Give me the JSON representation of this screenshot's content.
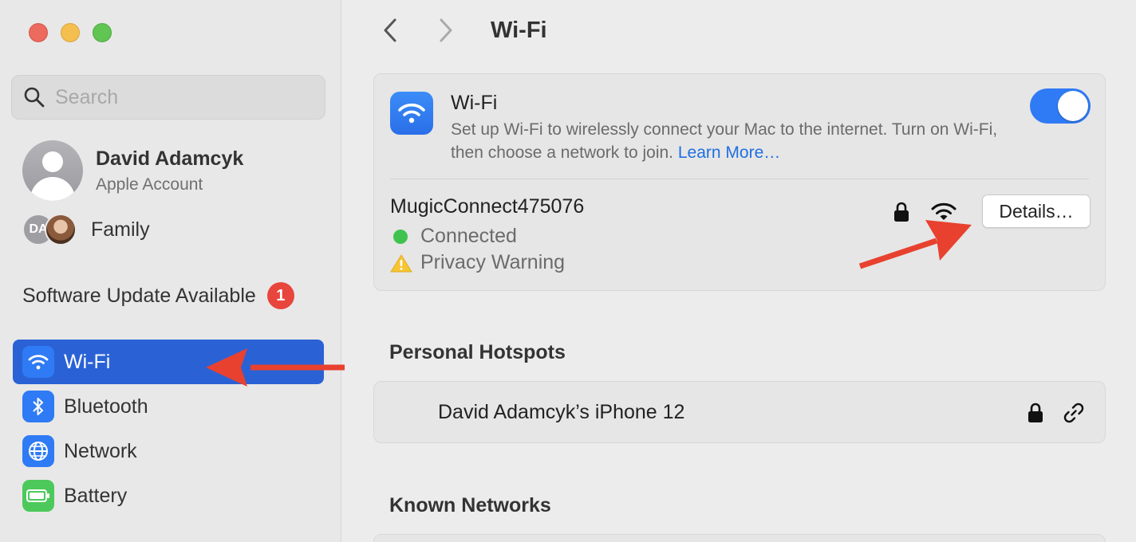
{
  "sidebar": {
    "search_placeholder": "Search",
    "account": {
      "name": "David Adamcyk",
      "subtitle": "Apple Account"
    },
    "family": {
      "initials": "DA",
      "label": "Family"
    },
    "software_update": {
      "label": "Software Update Available",
      "count": "1"
    },
    "items": [
      {
        "label": "Wi-Fi",
        "icon": "wifi-icon",
        "active": true
      },
      {
        "label": "Bluetooth",
        "icon": "bluetooth-icon",
        "active": false
      },
      {
        "label": "Network",
        "icon": "globe-icon",
        "active": false
      },
      {
        "label": "Battery",
        "icon": "battery-icon",
        "active": false
      }
    ]
  },
  "header": {
    "title": "Wi-Fi"
  },
  "wifi": {
    "title": "Wi-Fi",
    "description": "Set up Wi-Fi to wirelessly connect your Mac to the internet. Turn on Wi-Fi, then choose a network to join.",
    "learn_more": "Learn More…",
    "enabled": true
  },
  "current_network": {
    "name": "MugicConnect475076",
    "status": "Connected",
    "warning": "Privacy Warning",
    "details_label": "Details…"
  },
  "personal_hotspots": {
    "heading": "Personal Hotspots",
    "items": [
      {
        "name": "David Adamcyk’s iPhone 12"
      }
    ]
  },
  "known_networks": {
    "heading": "Known Networks"
  },
  "colors": {
    "accent": "#2f7bf5",
    "selection": "#2a62d6",
    "annotation_arrow": "#e8412f",
    "connected": "#3fc34e",
    "badge": "#e8453c"
  }
}
